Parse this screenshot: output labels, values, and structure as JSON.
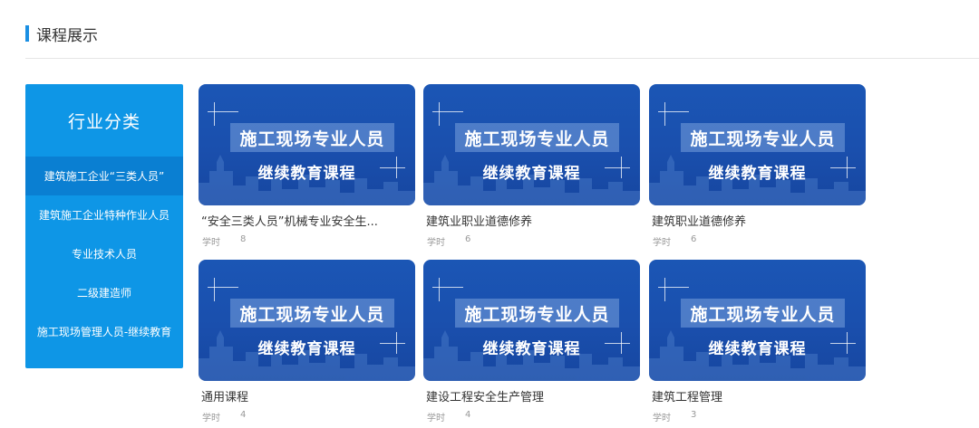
{
  "section": {
    "title": "课程展示"
  },
  "categories": {
    "title": "行业分类",
    "items": [
      {
        "label": "建筑施工企业“三类人员”",
        "active": true
      },
      {
        "label": "建筑施工企业特种作业人员"
      },
      {
        "label": "专业技术人员"
      },
      {
        "label": "二级建造师"
      },
      {
        "label": "施工现场管理人员-继续教育"
      }
    ]
  },
  "thumb": {
    "banner": "施工现场专业人员",
    "sub": "继续教育课程"
  },
  "meta_label": "学时",
  "courses": [
    {
      "name": "“安全三类人员”机械专业安全生...",
      "hours": "8"
    },
    {
      "name": "建筑业职业道德修养",
      "hours": "6"
    },
    {
      "name": "建筑职业道德修养",
      "hours": "6"
    },
    {
      "name": "通用课程",
      "hours": "4"
    },
    {
      "name": "建设工程安全生产管理",
      "hours": "4"
    },
    {
      "name": "建筑工程管理",
      "hours": "3"
    }
  ],
  "colors": {
    "accent": "#1a8fe3",
    "panel": "#0e96e6",
    "panel_active": "#0a7fd2",
    "thumb": "#1a4fad"
  }
}
